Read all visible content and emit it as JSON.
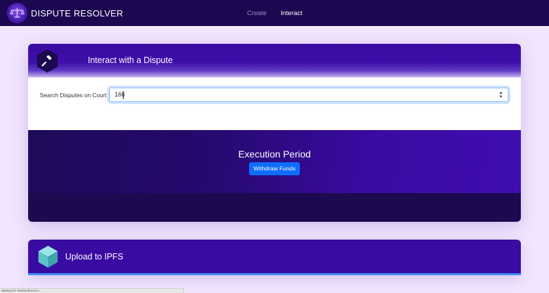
{
  "app": {
    "name": "DISPUTE RESOLVER"
  },
  "nav": {
    "items": [
      {
        "label": "Create",
        "active": false
      },
      {
        "label": "Interact",
        "active": true
      }
    ]
  },
  "interact_card": {
    "title": "Interact with a Dispute",
    "icon": "gavel-icon",
    "search": {
      "label": "Search Disputes on Court",
      "value": "166"
    },
    "period": {
      "title": "Execution Period",
      "button_label": "Withdraw Funds"
    }
  },
  "upload_card": {
    "title": "Upload to IPFS",
    "icon": "cube-icon"
  },
  "status_bar": {
    "text": "Waiting for rinkeby.kleros.io..."
  },
  "colors": {
    "navbar": "#1c0751",
    "card_header": "#3a0ba1",
    "primary_button": "#0d6efd",
    "page_background": "#f1e6fd"
  }
}
